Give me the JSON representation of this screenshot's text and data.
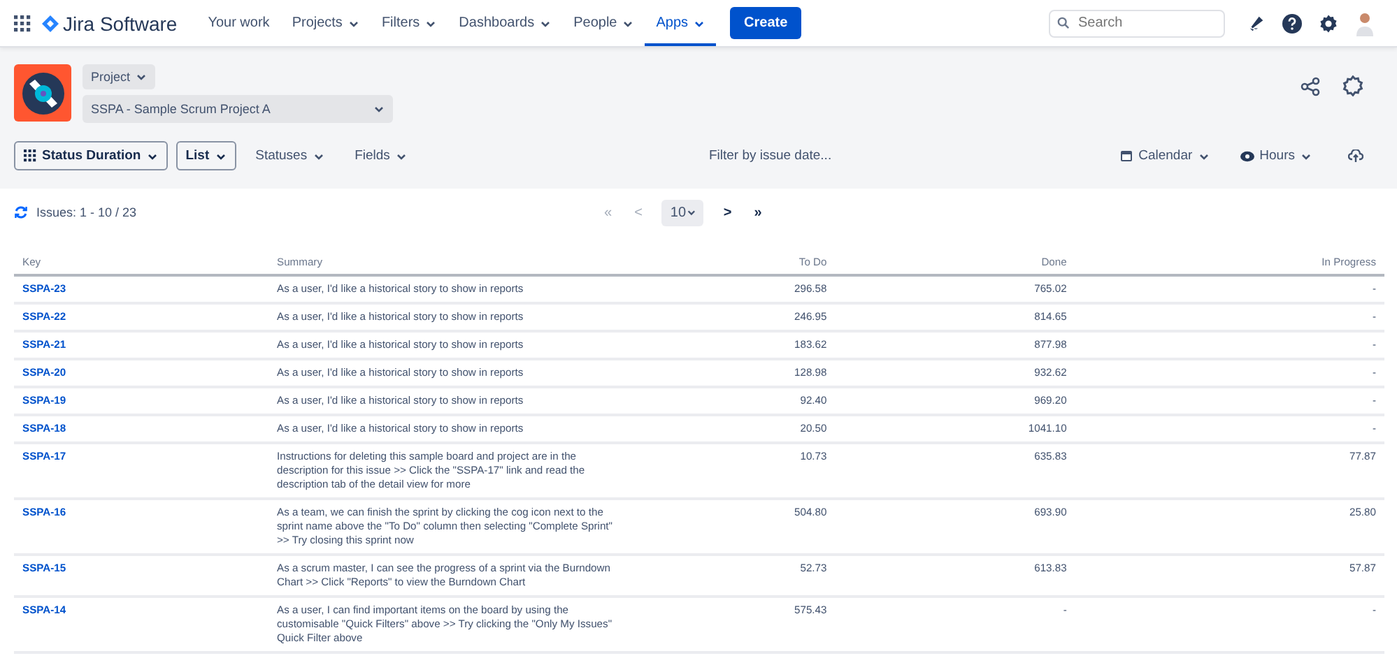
{
  "topbar": {
    "product": "Jira Software",
    "nav": [
      {
        "label": "Your work",
        "dropdown": false,
        "selected": false
      },
      {
        "label": "Projects",
        "dropdown": true,
        "selected": false
      },
      {
        "label": "Filters",
        "dropdown": true,
        "selected": false
      },
      {
        "label": "Dashboards",
        "dropdown": true,
        "selected": false
      },
      {
        "label": "People",
        "dropdown": true,
        "selected": false
      },
      {
        "label": "Apps",
        "dropdown": true,
        "selected": true
      }
    ],
    "create": "Create",
    "search": {
      "placeholder": "Search"
    }
  },
  "project": {
    "type_label": "Project",
    "name": "SSPA - Sample Scrum Project A"
  },
  "toolbar": {
    "report": "Status Duration",
    "view": "List",
    "menus": [
      "Statuses",
      "Fields"
    ],
    "date_filter": {
      "placeholder": "Filter by issue date..."
    },
    "calendar": "Calendar",
    "unit": "Hours"
  },
  "issues_count": "Issues: 1 - 10 / 23",
  "pager": {
    "page_size": "10",
    "buttons": [
      {
        "label": "«",
        "disabled": true
      },
      {
        "label": "<",
        "disabled": true
      },
      {
        "label": ">",
        "disabled": false
      },
      {
        "label": "»",
        "disabled": false
      }
    ]
  },
  "table": {
    "columns": [
      "Key",
      "Summary",
      "To Do",
      "Done",
      "In Progress"
    ],
    "rows": [
      {
        "key": "SSPA-23",
        "summary": "As a user, I'd like a historical story to show in reports",
        "todo": "296.58",
        "done": "765.02",
        "in_progress": "-"
      },
      {
        "key": "SSPA-22",
        "summary": "As a user, I'd like a historical story to show in reports",
        "todo": "246.95",
        "done": "814.65",
        "in_progress": "-"
      },
      {
        "key": "SSPA-21",
        "summary": "As a user, I'd like a historical story to show in reports",
        "todo": "183.62",
        "done": "877.98",
        "in_progress": "-"
      },
      {
        "key": "SSPA-20",
        "summary": "As a user, I'd like a historical story to show in reports",
        "todo": "128.98",
        "done": "932.62",
        "in_progress": "-"
      },
      {
        "key": "SSPA-19",
        "summary": "As a user, I'd like a historical story to show in reports",
        "todo": "92.40",
        "done": "969.20",
        "in_progress": "-"
      },
      {
        "key": "SSPA-18",
        "summary": "As a user, I'd like a historical story to show in reports",
        "todo": "20.50",
        "done": "1041.10",
        "in_progress": "-"
      },
      {
        "key": "SSPA-17",
        "summary": "Instructions for deleting this sample board and project are in the description for this issue >> Click the \"SSPA-17\" link and read the description tab of the detail view for more",
        "todo": "10.73",
        "done": "635.83",
        "in_progress": "77.87"
      },
      {
        "key": "SSPA-16",
        "summary": "As a team, we can finish the sprint by clicking the cog icon next to the sprint name above the \"To Do\" column then selecting \"Complete Sprint\" >> Try closing this sprint now",
        "todo": "504.80",
        "done": "693.90",
        "in_progress": "25.80"
      },
      {
        "key": "SSPA-15",
        "summary": "As a scrum master, I can see the progress of a sprint via the Burndown Chart >> Click \"Reports\" to view the Burndown Chart",
        "todo": "52.73",
        "done": "613.83",
        "in_progress": "57.87"
      },
      {
        "key": "SSPA-14",
        "summary": "As a user, I can find important items on the board by using the customisable \"Quick Filters\" above >> Try clicking the \"Only My Issues\" Quick Filter above",
        "todo": "575.43",
        "done": "-",
        "in_progress": "-"
      }
    ]
  }
}
